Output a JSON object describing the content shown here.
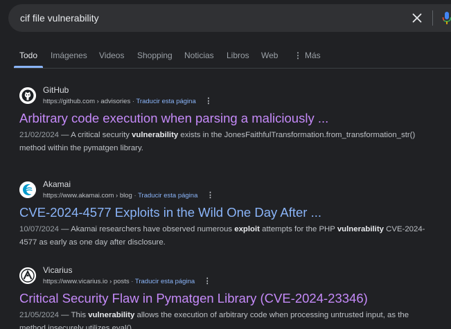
{
  "search": {
    "query": "cif file vulnerability"
  },
  "tabs": [
    {
      "label": "Todo"
    },
    {
      "label": "Imágenes"
    },
    {
      "label": "Videos"
    },
    {
      "label": "Shopping"
    },
    {
      "label": "Noticias"
    },
    {
      "label": "Libros"
    },
    {
      "label": "Web"
    },
    {
      "label": "Más"
    }
  ],
  "results": [
    {
      "site": "GitHub",
      "url": "https://github.com › advisories",
      "translate": "Traducir esta página",
      "title": "Arbitrary code execution when parsing a maliciously ...",
      "date": "21/02/2024",
      "snippet_a": " — A critical security ",
      "snippet_b": "vulnerability",
      "snippet_c": " exists in the JonesFaithfulTransformation.from_transformation_str() method within the pymatgen library.",
      "icon": "github-icon"
    },
    {
      "site": "Akamai",
      "url": "https://www.akamai.com › blog",
      "translate": "Traducir esta página",
      "title": "CVE-2024-4577 Exploits in the Wild One Day After ...",
      "date": "10/07/2024",
      "snippet_a": " — Akamai researchers have observed numerous ",
      "snippet_b": "exploit",
      "snippet_c": " attempts for the PHP ",
      "snippet_d": "vulnerability",
      "snippet_e": " CVE-2024-4577 as early as one day after disclosure.",
      "icon": "akamai-icon"
    },
    {
      "site": "Vicarius",
      "url": "https://www.vicarius.io › posts",
      "translate": "Traducir esta página",
      "title": "Critical Security Flaw in Pymatgen Library (CVE-2024-23346)",
      "date": "21/05/2024",
      "snippet_a": " — This ",
      "snippet_b": "vulnerability",
      "snippet_c": " allows the execution of arbitrary code when processing untrusted input, as the method insecurely utilizes eval().",
      "icon": "vicarius-icon"
    }
  ],
  "colors": {
    "background": "#202124",
    "link_visited": "#c58af9",
    "link_unvisited": "#8ab4f8",
    "accent": "#8ab4f8"
  }
}
